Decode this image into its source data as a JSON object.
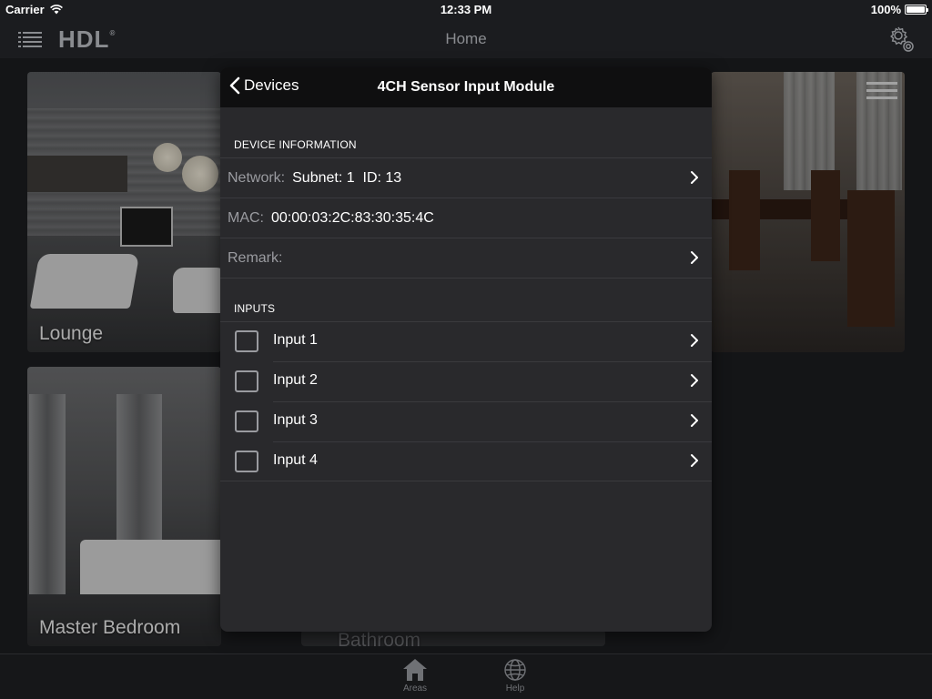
{
  "status_bar": {
    "carrier": "Carrier",
    "time": "12:33 PM",
    "battery": "100%"
  },
  "nav": {
    "logo": "HDL",
    "logo_mark": "®",
    "title": "Home"
  },
  "areas": [
    {
      "label": "Lounge"
    },
    {
      "label": "Master Bedroom"
    },
    {
      "label": "Bathroom"
    }
  ],
  "tabs": [
    {
      "label": "Areas",
      "icon": "house-icon"
    },
    {
      "label": "Help",
      "icon": "globe-icon"
    }
  ],
  "modal": {
    "back_label": "Devices",
    "title": "4CH Sensor Input Module",
    "device_section": "DEVICE INFORMATION",
    "network_label": "Network:",
    "network_value": "Subnet: 1  ID: 13",
    "mac_label": "MAC:",
    "mac_value": "00:00:03:2C:83:30:35:4C",
    "remark_label": "Remark:",
    "inputs_section": "INPUTS",
    "inputs": [
      {
        "label": "Input 1"
      },
      {
        "label": "Input 2"
      },
      {
        "label": "Input 3"
      },
      {
        "label": "Input 4"
      }
    ]
  },
  "colors": {
    "background": "#1b1c1f",
    "modal_bg": "#29292c",
    "modal_header": "#0f0f10",
    "muted_text": "#9a9ba0",
    "separator": "#3a3a3e"
  }
}
